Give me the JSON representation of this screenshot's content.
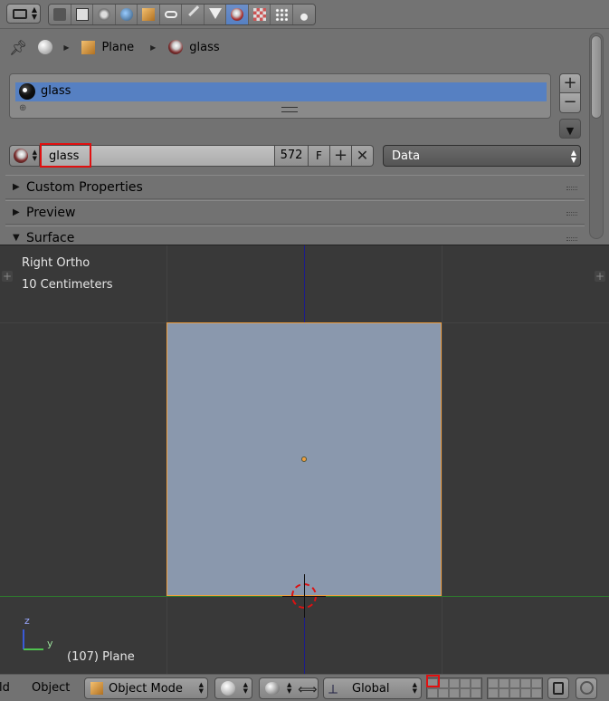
{
  "properties": {
    "context_tabs": [
      "render-icon",
      "render-layers-icon",
      "scene-icon",
      "world-icon",
      "object-icon",
      "constraints-icon",
      "modifiers-icon",
      "data-icon",
      "material-icon",
      "texture-icon",
      "particles-icon",
      "physics-icon"
    ],
    "active_tab": "material-icon",
    "breadcrumb": {
      "object": "Plane",
      "material": "glass"
    },
    "material_slots": [
      {
        "name": "glass"
      }
    ],
    "id_block": {
      "name": "glass",
      "users": "572",
      "fake_user": "F"
    },
    "link_select": "Data",
    "panels": [
      {
        "label": "Custom Properties",
        "state": "collapsed"
      },
      {
        "label": "Preview",
        "state": "collapsed"
      },
      {
        "label": "Surface",
        "state": "expanded"
      }
    ]
  },
  "viewport": {
    "view_name": "Right Ortho",
    "grid_scale": "10 Centimeters",
    "object_info": "(107) Plane",
    "axis_z": "z",
    "axis_y": "y",
    "colors": {
      "background": "#393939",
      "plane": "#8a98ad",
      "selection": "#f0a040",
      "z_axis": "#1c1c8a",
      "y_axis": "#2e7d2e"
    }
  },
  "header_3d": {
    "view_menu_partial": "ld",
    "object_menu": "Object",
    "mode": "Object Mode",
    "orientation": "Global"
  }
}
